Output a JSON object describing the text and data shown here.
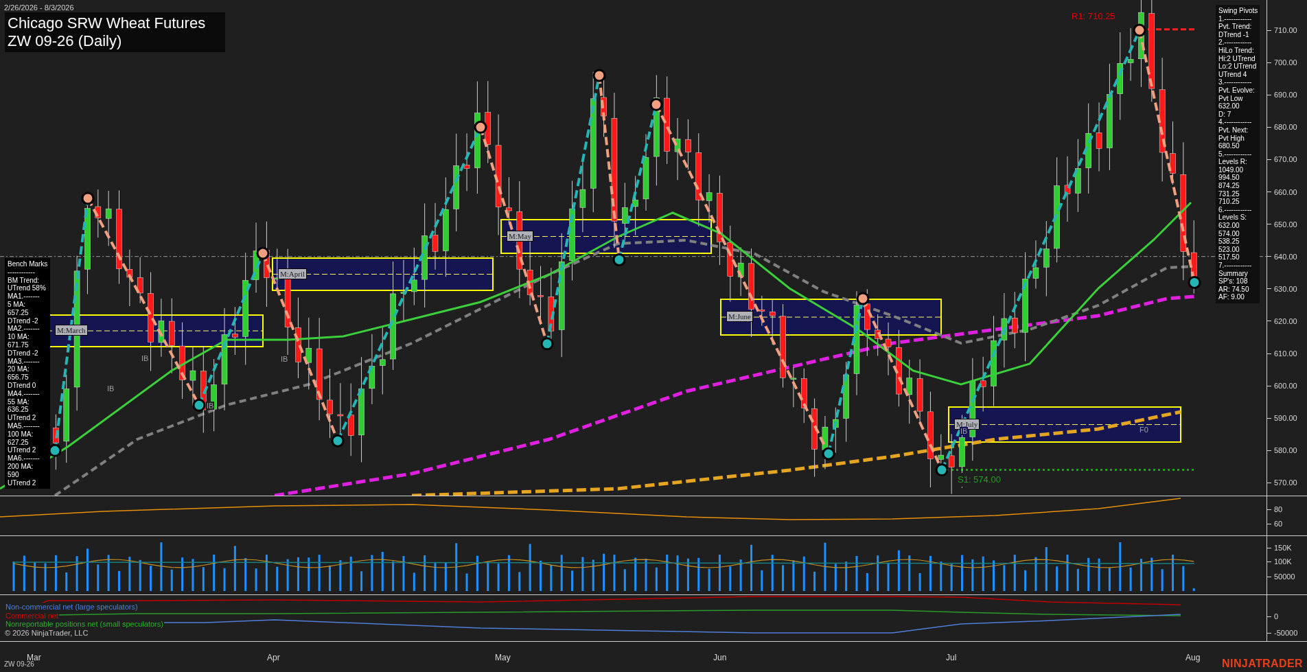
{
  "date_range": "2/26/2026 - 8/3/2026",
  "title": {
    "line1": "Chicago SRW Wheat Futures",
    "line2": "ZW 09-26 (Daily)"
  },
  "bench_marks": [
    "Bench Marks",
    "------------",
    "BM Trend:",
    "UTrend 58%",
    "MA1.-------",
    "5 MA:",
    "657.25",
    "DTrend -2",
    "MA2.-------",
    "10 MA:",
    "671.75",
    "DTrend -2",
    "MA3.-------",
    "20 MA:",
    "656.75",
    "DTrend 0",
    "MA4.-------",
    "55 MA:",
    "636.25",
    "UTrend 2",
    "MA5.-------",
    "100 MA:",
    "627.25",
    "UTrend 2",
    "MA6.-------",
    "200 MA:",
    "590",
    "UTrend 2"
  ],
  "swing_pivots": [
    "Swing Pivots",
    "1.------------",
    "Pvt. Trend:",
    "DTrend -1",
    "2.------------",
    "HiLo Trend:",
    "Hi:2 UTrend",
    "Lo:2 UTrend",
    "UTrend 4",
    "3.------------",
    "Pvt. Evolve:",
    "Pvt Low",
    "632.00",
    "D: 7",
    "4.------------",
    "Pvt. Next:",
    "Pvt High",
    "680.50",
    "5.------------",
    "Levels R:",
    "1049.00",
    "994.50",
    "874.25",
    "731.25",
    "710.25",
    "6.------------",
    "Levels S:",
    "632.00",
    "574.00",
    "538.25",
    "523.00",
    "517.50",
    "7.------------",
    "Summary",
    "SP's: 108",
    "AR: 74.50",
    "AF: 9.00"
  ],
  "month_boxes": [
    {
      "label": "M:March"
    },
    {
      "label": "M:April"
    },
    {
      "label": "M:May"
    },
    {
      "label": "M:June"
    },
    {
      "label": "M:July"
    }
  ],
  "chart_labels": {
    "resistance": "R1: 710.25",
    "support": "S1: 574.00",
    "ib": [
      "IB",
      "IB",
      "IB",
      "IB"
    ],
    "ib_july": "IB",
    "f0": "F0"
  },
  "price_axis": [
    "710.00",
    "700.00",
    "690.00",
    "680.00",
    "670.00",
    "660.00",
    "650.00",
    "640.00",
    "630.00",
    "620.00",
    "610.00",
    "600.00",
    "590.00",
    "580.00",
    "570.00"
  ],
  "oscillator_axis": [
    "80",
    "60"
  ],
  "volume_axis": [
    "150K",
    "100K",
    "50000"
  ],
  "cot_axis": [
    "0",
    "-50000"
  ],
  "cot_legend": [
    {
      "label": "Non-commercial net (large speculators)",
      "color": "#4f7fd8"
    },
    {
      "label": "Commercial net",
      "color": "#e00000"
    },
    {
      "label": "Nonreportable positions net (small speculators)",
      "color": "#2eae2e"
    }
  ],
  "copyright": "© 2026 NinjaTrader, LLC",
  "time_axis": [
    "Mar",
    "Apr",
    "May",
    "Jun",
    "Jul",
    "Aug"
  ],
  "footer": {
    "instrument": "ZW 09-26",
    "logo": "NINJATRADER"
  }
}
